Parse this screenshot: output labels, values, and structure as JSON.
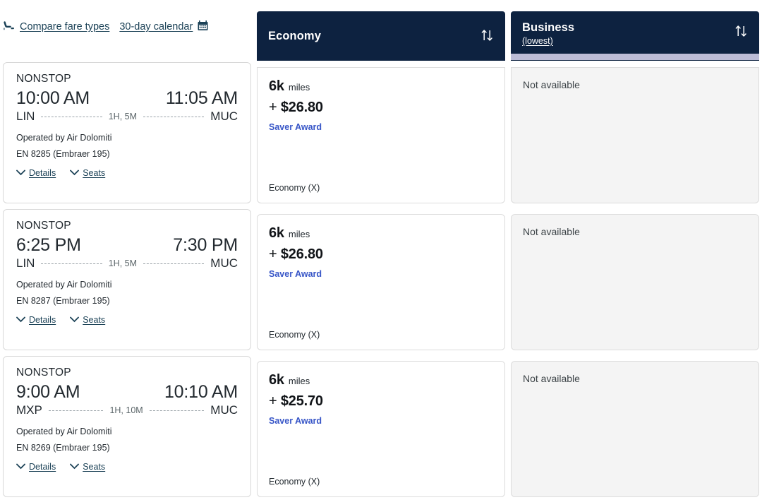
{
  "toolbar": {
    "compare_label": "Compare fare types",
    "calendar_label": "30-day calendar",
    "seat_icon": "seat-icon",
    "calendar_icon": "calendar-icon"
  },
  "columns": [
    {
      "key": "economy",
      "title": "Economy",
      "subtitle": "",
      "sort_icon": "sort-arrows-icon"
    },
    {
      "key": "business",
      "title": "Business",
      "subtitle": "(lowest)",
      "sort_icon": "sort-arrows-icon"
    }
  ],
  "card_links": {
    "details_label": "Details",
    "seats_label": "Seats",
    "chevron_icon": "chevron-down-icon"
  },
  "colors": {
    "header_navy": "#0d2240",
    "accent_lavender": "#bcbcd6",
    "award_blue": "#3755c7",
    "link_teal": "#1c4257",
    "unavailable_bg": "#f4f4f4"
  },
  "rows": [
    {
      "flight": {
        "stops": "NONSTOP",
        "depart_time": "10:00 AM",
        "arrive_time": "11:05 AM",
        "origin": "LIN",
        "destination": "MUC",
        "duration": "1H, 5M",
        "operator": "Operated by Air Dolomiti",
        "flight_number": "EN 8285 (Embraer 195)"
      },
      "economy": {
        "miles": "6k",
        "miles_unit": "miles",
        "plus": "+",
        "cash": "$26.80",
        "award": "Saver Award",
        "cabin": "Economy (X)"
      },
      "business": {
        "status": "Not available"
      }
    },
    {
      "flight": {
        "stops": "NONSTOP",
        "depart_time": "6:25 PM",
        "arrive_time": "7:30 PM",
        "origin": "LIN",
        "destination": "MUC",
        "duration": "1H, 5M",
        "operator": "Operated by Air Dolomiti",
        "flight_number": "EN 8287 (Embraer 195)"
      },
      "economy": {
        "miles": "6k",
        "miles_unit": "miles",
        "plus": "+",
        "cash": "$26.80",
        "award": "Saver Award",
        "cabin": "Economy (X)"
      },
      "business": {
        "status": "Not available"
      }
    },
    {
      "flight": {
        "stops": "NONSTOP",
        "depart_time": "9:00 AM",
        "arrive_time": "10:10 AM",
        "origin": "MXP",
        "destination": "MUC",
        "duration": "1H, 10M",
        "operator": "Operated by Air Dolomiti",
        "flight_number": "EN 8269 (Embraer 195)"
      },
      "economy": {
        "miles": "6k",
        "miles_unit": "miles",
        "plus": "+",
        "cash": "$25.70",
        "award": "Saver Award",
        "cabin": "Economy (X)"
      },
      "business": {
        "status": "Not available"
      }
    }
  ]
}
